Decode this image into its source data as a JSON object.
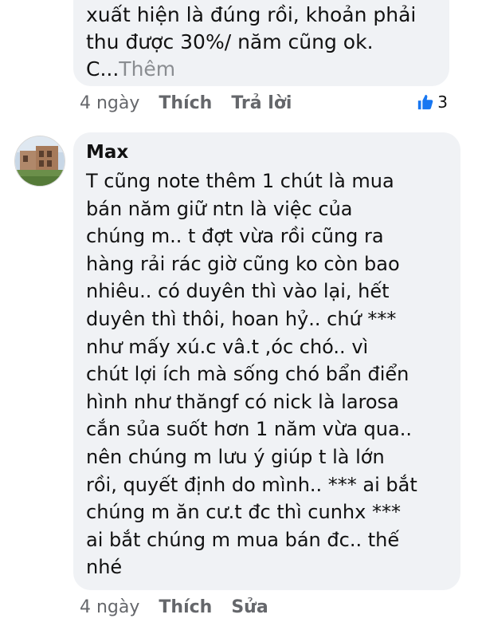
{
  "comment_1": {
    "text_visible": "xuất hiện là đúng rồi, khoản phải\nthu được 30%/ năm cũng ok.\nC...",
    "see_more": "Thêm",
    "time": "4 ngày",
    "like_label": "Thích",
    "reply_label": "Trả lời",
    "reaction_count": "3",
    "reaction_icon": "thumbs-up-icon",
    "reaction_color": "#1877f2"
  },
  "comment_2": {
    "author": "Max",
    "body": "T cũng note thêm 1 chút là mua\nbán năm giữ ntn là việc của\nchúng m.. t đợt vừa rồi cũng ra\nhàng rải rác giờ cũng ko còn bao\nnhiêu.. có duyên thì vào lại, hết\nduyên thì thôi, hoan hỷ.. chứ ***\nnhư mấy xú.c vâ.t ,óc chó.. vì\nchút lợi ích mà sống chó bẩn điển\nhình như thăngf có nick là larosa\ncắn sủa suốt hơn 1 năm vừa qua..\nnên chúng m lưu ý giúp t là lớn\nrồi, quyết định do mình.. *** ai bắt\nchúng m ăn cư.t đc thì cunhx ***\nai bắt chúng m mua bán đc.. thế\nnhé",
    "time": "4 ngày",
    "like_label": "Thích",
    "edit_label": "Sửa"
  },
  "colors": {
    "bubble_bg": "#f0f2f5",
    "meta_text": "#65676b",
    "body_text": "#111111"
  }
}
